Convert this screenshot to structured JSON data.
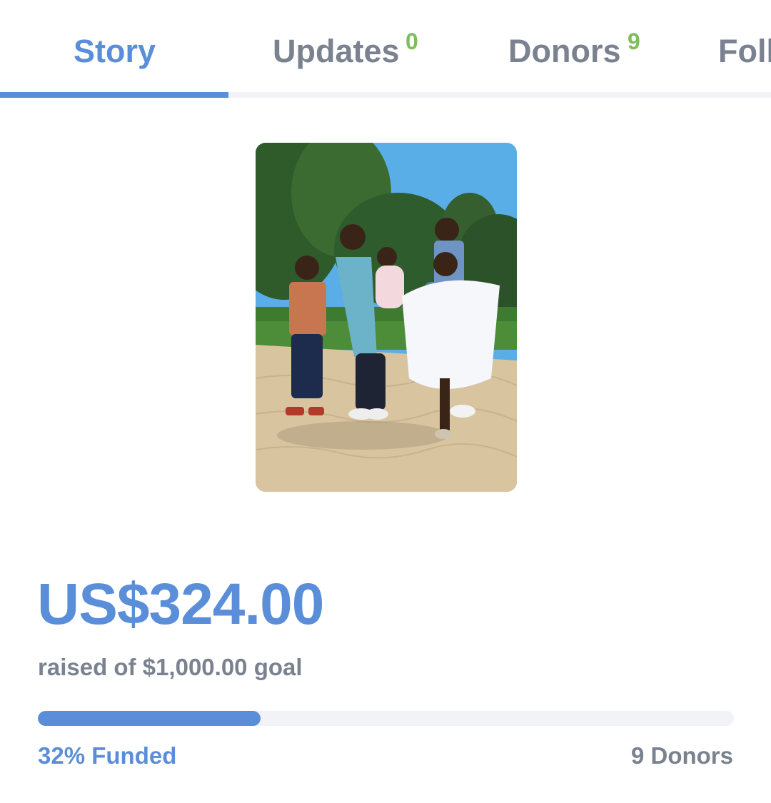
{
  "tabs": {
    "story": {
      "label": "Story"
    },
    "updates": {
      "label": "Updates",
      "count": "0"
    },
    "donors": {
      "label": "Donors",
      "count": "9"
    },
    "followers": {
      "label": "Foll"
    }
  },
  "campaign": {
    "amount_raised": "US$324.00",
    "goal_text": "raised of $1,000.00 goal",
    "progress_fraction": 0.32,
    "funded_text": "32% Funded",
    "donors_text": "9 Donors"
  },
  "colors": {
    "accent": "#5b8ed9",
    "text_muted": "#7a8290",
    "badge_green": "#7cbf5a",
    "track": "#f1f3f6"
  }
}
